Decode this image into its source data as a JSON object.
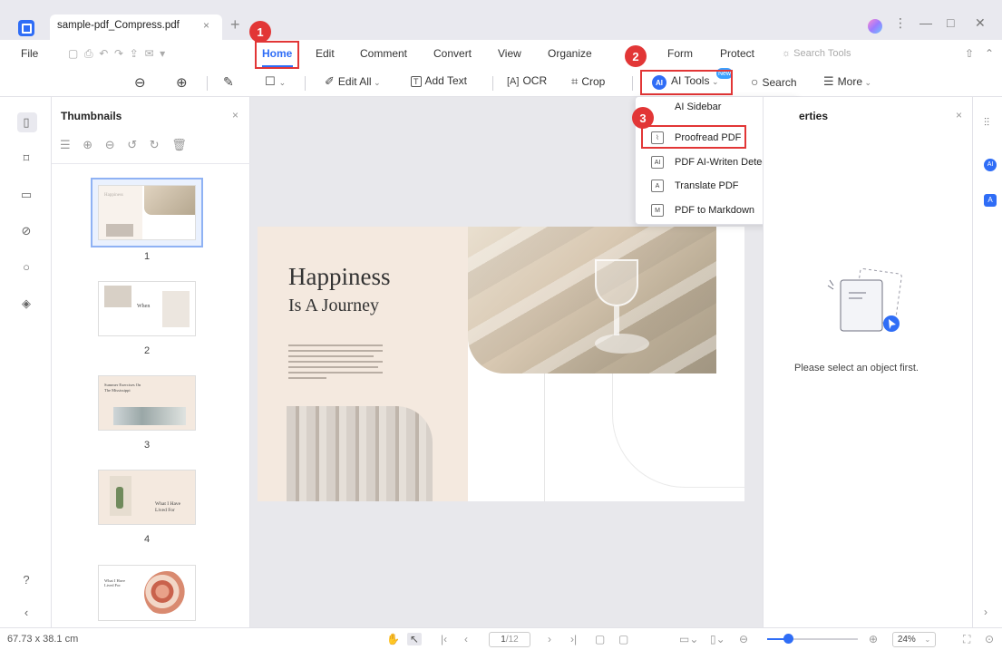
{
  "window": {
    "tab_title": "sample-pdf_Compress.pdf",
    "tab_close": "×",
    "tab_add": "+",
    "controls": [
      "⋮",
      "—",
      "□",
      "✕"
    ]
  },
  "menu": {
    "items": [
      "File",
      "Home",
      "Edit",
      "Comment",
      "Convert",
      "View",
      "Organize",
      "Form",
      "Protect"
    ],
    "active": "Home",
    "search_placeholder": "Search Tools"
  },
  "toolbar": {
    "edit_all": "Edit All",
    "add_text": "Add Text",
    "ocr": "OCR",
    "crop": "Crop",
    "ai_tools": "AI Tools",
    "ai_badge": "AI",
    "new_badge": "New",
    "search": "Search",
    "more": "More"
  },
  "annotations": {
    "markers": [
      "1",
      "2",
      "3"
    ]
  },
  "ai_dropdown": {
    "header": "AI Sidebar",
    "items": [
      {
        "icon": "proofread-icon",
        "label": "Proofread PDF"
      },
      {
        "icon": "ai-detect-icon",
        "label": "PDF AI-Writen Detect"
      },
      {
        "icon": "translate-icon",
        "label": "Translate PDF"
      },
      {
        "icon": "markdown-icon",
        "label": "PDF to Markdown"
      }
    ]
  },
  "thumbnails": {
    "title": "Thumbnails",
    "close": "×",
    "pages": [
      {
        "num": "1",
        "caption": "Happiness"
      },
      {
        "num": "2",
        "caption": "When"
      },
      {
        "num": "3",
        "caption": "Summer Exercises On The Mississippi"
      },
      {
        "num": "4",
        "caption": "What I Have Lived For"
      },
      {
        "num": "",
        "caption": "What I Have Lived For"
      }
    ]
  },
  "document": {
    "heading": "Happiness",
    "subheading": "Is A Journey"
  },
  "properties": {
    "title": "Properties",
    "title_visible": "erties",
    "close": "×",
    "message": "Please select an object first."
  },
  "status": {
    "dimensions": "67.73 x 38.1 cm",
    "page_current": "1",
    "page_total": "/12",
    "zoom": "24%",
    "zoom_fraction": 0.24
  },
  "colors": {
    "accent": "#2f6df6",
    "annotation": "#e23636"
  }
}
